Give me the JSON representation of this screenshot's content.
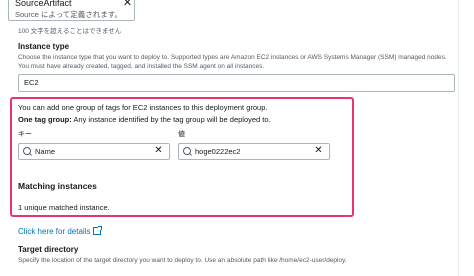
{
  "token": {
    "title": "SourceArtifact",
    "subtitle": "Source によって定義されます。",
    "close_icon": "close-icon"
  },
  "char_limit_note": "100 文字を超えることはできません",
  "instance_type": {
    "label": "Instance type",
    "description": "Choose the instance type that you want to deploy to. Supported types are Amazon EC2 instances or AWS Systems Manager (SSM) managed nodes. You must have already created, tagged, and installed the SSM agent on all instances.",
    "selected": "EC2"
  },
  "tag_group": {
    "intro": "You can add one group of tags for EC2 instances to this deployment group.",
    "one_tag_bold": "One tag group:",
    "one_tag_rest": " Any instance identified by the tag group will be deployed to.",
    "key_label": "キー",
    "value_label": "値",
    "key_value": "Name",
    "value_value": "hoge0222ec2",
    "search_icon": "search-icon",
    "clear_icon": "close-icon"
  },
  "matching": {
    "heading": "Matching instances",
    "count_text": "1 unique matched instance."
  },
  "details_link": "Click here for details",
  "target_directory": {
    "label": "Target directory",
    "description": "Specify the location of the target directory you want to deploy to. Use an absolute path like /home/ec2-user/deploy."
  },
  "colors": {
    "highlight": "#e8356d",
    "link": "#0073bb"
  }
}
